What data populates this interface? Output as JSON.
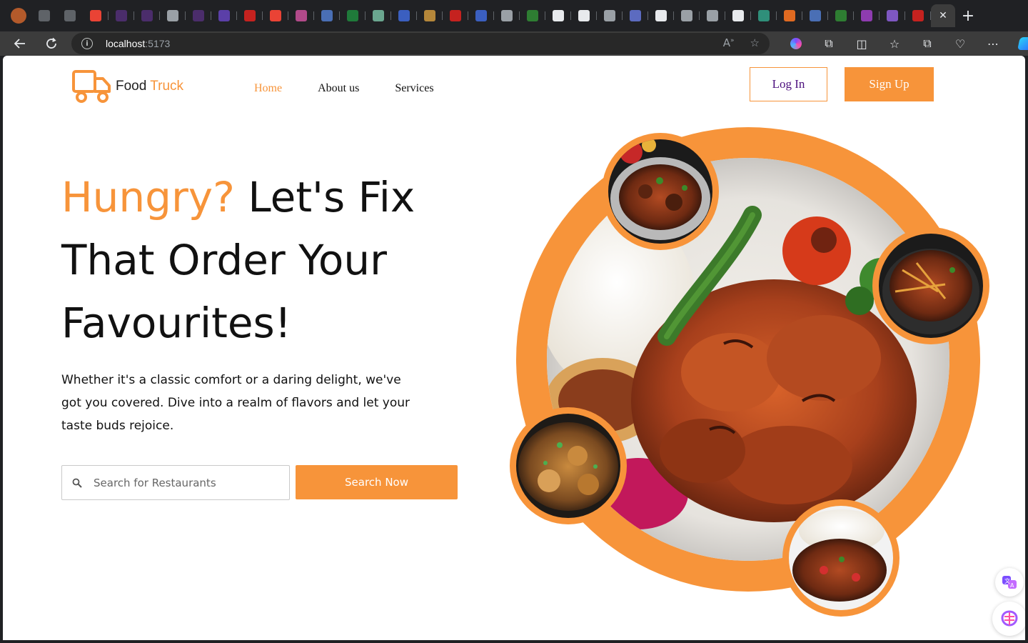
{
  "browser": {
    "url_host": "localhost",
    "url_port": ":5173",
    "tabs": [
      {
        "icon": "profile-avatar-icon",
        "color": "#b35a2b"
      },
      {
        "icon": "workspaces-icon",
        "color": "#5f6368"
      },
      {
        "icon": "tab-actions-icon",
        "color": "#5f6368"
      },
      {
        "icon": "gmail-icon",
        "color": "#ea4335"
      },
      {
        "icon": "purple-app-icon",
        "color": "#4b2d6b"
      },
      {
        "icon": "purple-app-icon",
        "color": "#4b2d6b"
      },
      {
        "icon": "info-icon",
        "color": "#9aa0a6"
      },
      {
        "icon": "purple-app-icon",
        "color": "#4b2d6b"
      },
      {
        "icon": "django-icon",
        "color": "#5b3fa8"
      },
      {
        "icon": "pdf-icon",
        "color": "#c5221f"
      },
      {
        "icon": "gmail-icon",
        "color": "#ea4335"
      },
      {
        "icon": "screen-icon",
        "color": "#b24a8a"
      },
      {
        "icon": "docs-icon",
        "color": "#4a6fb5"
      },
      {
        "icon": "mongodb-icon",
        "color": "#1f7a3a"
      },
      {
        "icon": "chatgpt-icon",
        "color": "#6aa68f"
      },
      {
        "icon": "c-icon",
        "color": "#3b5fc0"
      },
      {
        "icon": "cat-icon",
        "color": "#b5873a"
      },
      {
        "icon": "youtube-icon",
        "color": "#c5221f"
      },
      {
        "icon": "search-tab-icon",
        "color": "#3b5fc0"
      },
      {
        "icon": "hourglass-icon",
        "color": "#9aa0a6"
      },
      {
        "icon": "recycle-icon",
        "color": "#2e7d32"
      },
      {
        "icon": "github-icon",
        "color": "#e8eaed"
      },
      {
        "icon": "github-icon",
        "color": "#e8eaed"
      },
      {
        "icon": "signal-icon",
        "color": "#9aa0a6"
      },
      {
        "icon": "api-icon",
        "color": "#5c6bc0"
      },
      {
        "icon": "triangle-icon",
        "color": "#e8eaed"
      },
      {
        "icon": "file-icon",
        "color": "#9aa0a6"
      },
      {
        "icon": "file-icon",
        "color": "#9aa0a6"
      },
      {
        "icon": "triangle-icon",
        "color": "#e8eaed"
      },
      {
        "icon": "teal-app-icon",
        "color": "#2f8f7a"
      },
      {
        "icon": "hackernews-icon",
        "color": "#e06a21"
      },
      {
        "icon": "docs-icon",
        "color": "#4a6fb5"
      },
      {
        "icon": "globe-icon",
        "color": "#2e7d32"
      },
      {
        "icon": "purple-dot-icon",
        "color": "#8e3cb0"
      },
      {
        "icon": "list-icon",
        "color": "#7e57c2"
      },
      {
        "icon": "powerpoint-icon",
        "color": "#c5221f"
      }
    ]
  },
  "site": {
    "logo_word1": "Food",
    "logo_word2": " Truck",
    "nav": {
      "home": "Home",
      "about": "About us",
      "services": "Services"
    },
    "login_label": "Log In",
    "signup_label": "Sign Up",
    "headline_accent": "Hungry?",
    "headline_rest": " Let's Fix That Order Your Favourites!",
    "subtext": "Whether it's a classic comfort or a daring delight, we've got you covered. Dive into a realm of flavors and let your taste buds rejoice.",
    "search_placeholder": "Search for Restaurants",
    "search_button": "Search Now"
  },
  "colors": {
    "accent": "#f7943a",
    "login_text": "#4b0f7d"
  }
}
